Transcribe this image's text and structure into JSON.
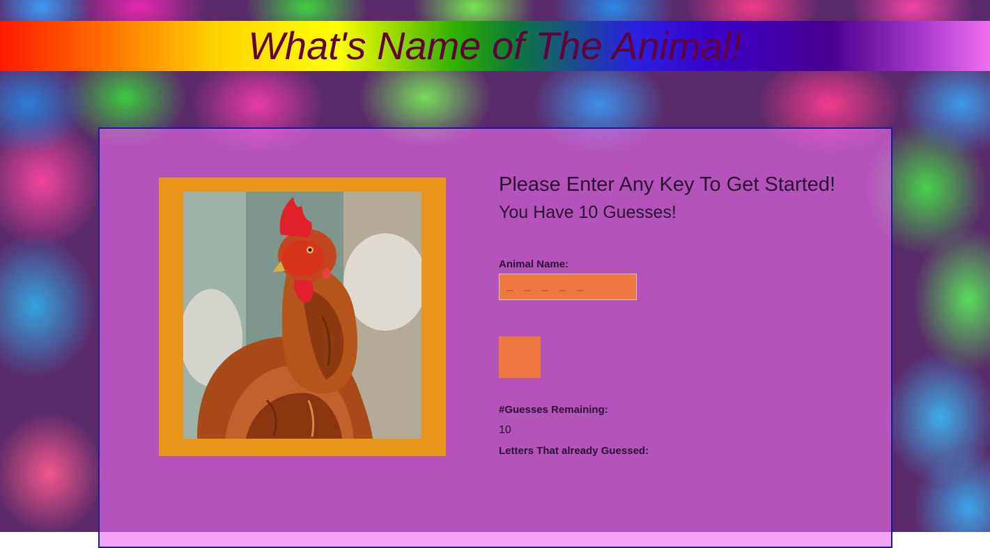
{
  "header": {
    "title": "What's Name of The Animal!"
  },
  "game": {
    "start_message": "Please Enter Any Key To Get Started!",
    "guesses_message": "You Have 10 Guesses!",
    "animal_name_label": "Animal Name:",
    "animal_name_value": "_ _ _ _ _",
    "guesses_remaining_label": "#Guesses Remaining:",
    "guesses_remaining_value": "10",
    "letters_guessed_label": "Letters That already Guessed:",
    "letters_guessed_value": ""
  },
  "image": {
    "subject": "chicken",
    "frame_color": "#e8961a"
  },
  "colors": {
    "title_text": "#62003a",
    "panel_border": "#1a1aa0",
    "input_fill": "#ee7840"
  }
}
